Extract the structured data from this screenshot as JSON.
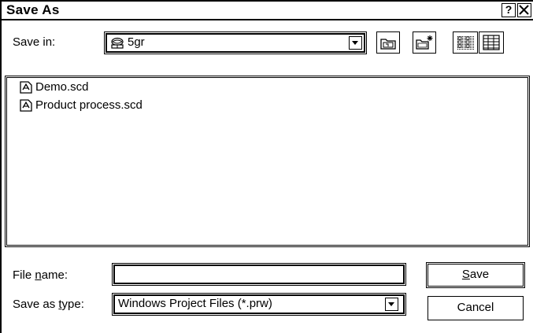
{
  "window": {
    "title": "Save As",
    "help_label": "?"
  },
  "save_in": {
    "label": "Save in:",
    "value": "5gr",
    "icon": "network-drive-icon"
  },
  "toolbar": {
    "icons": [
      "up-one-level-icon",
      "new-folder-icon",
      "list-view-icon",
      "details-view-icon"
    ]
  },
  "files": [
    {
      "name": "Demo.scd",
      "icon": "document-icon"
    },
    {
      "name": "Product process.scd",
      "icon": "document-icon"
    }
  ],
  "file_name": {
    "label_before": "File ",
    "label_mnemonic": "n",
    "label_after": "ame:",
    "value": ""
  },
  "save_as_type": {
    "label_before": "Save as ",
    "label_mnemonic": "t",
    "label_after": "ype:",
    "value": "Windows Project Files (*.prw)"
  },
  "buttons": {
    "save_mnemonic": "S",
    "save_rest": "ave",
    "cancel": "Cancel"
  }
}
